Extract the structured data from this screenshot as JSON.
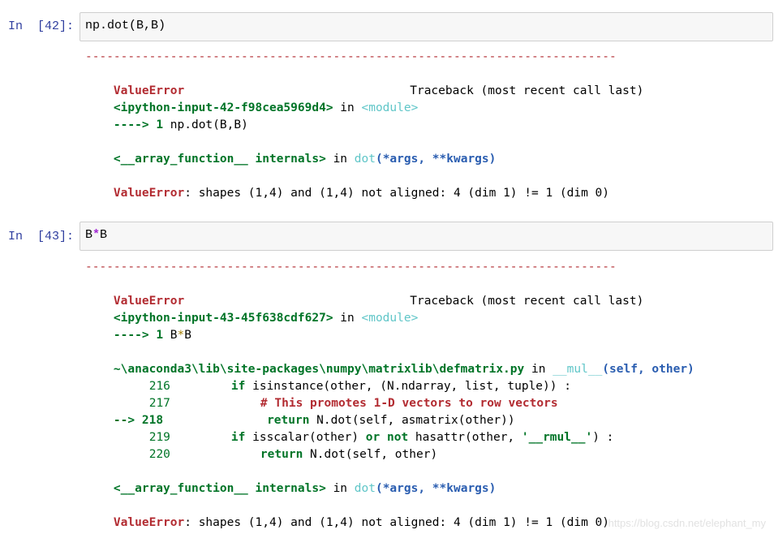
{
  "cells": [
    {
      "prompt": "In  [42]:",
      "code": {
        "fn": "np.dot",
        "args": "(B,B)"
      },
      "output": {
        "dashes": "---------------------------------------------------------------------------",
        "err_name": "ValueError",
        "tb_header": "Traceback (most recent call last)",
        "input_ref": "<ipython-input-42-f98cea5969d4>",
        "in_word": "in",
        "module": "<module>",
        "arrow": "---->",
        "line_no": "1",
        "line_code": "np.dot(B,B)",
        "internals": "<__array_function__ internals>",
        "internals_in": "in",
        "internals_fn": "dot",
        "internals_args": "(*args, **kwargs)",
        "err_label": "ValueError",
        "err_msg": ": shapes (1,4) and (1,4) not aligned: 4 (dim 1) != 1 (dim 0)"
      }
    },
    {
      "prompt": "In  [43]:",
      "code": {
        "a": "B",
        "op": "*",
        "b": "B"
      },
      "output": {
        "dashes": "---------------------------------------------------------------------------",
        "err_name": "ValueError",
        "tb_header": "Traceback (most recent call last)",
        "input_ref": "<ipython-input-43-45f638cdf627>",
        "in_word": "in",
        "module": "<module>",
        "arrow": "---->",
        "line_no": "1",
        "line_code_a": "B",
        "line_code_op": "*",
        "line_code_b": "B",
        "file_path": "~\\anaconda3\\lib\\site-packages\\numpy\\matrixlib\\defmatrix.py",
        "file_in": "in",
        "file_fn": "__mul__",
        "file_args": "(self, other)",
        "src": {
          "l216_no": "216",
          "l216_kw": "if",
          "l216_code": " isinstance(other, (N.ndarray, list, tuple)) :",
          "l217_no": "217",
          "l217_comment": "# This promotes 1-D vectors to row vectors",
          "l218_arrow": "-->",
          "l218_no": "218",
          "l218_kw": "return",
          "l218_code": " N.dot(self, asmatrix(other))",
          "l219_no": "219",
          "l219_kw": "if",
          "l219_code1": " isscalar(other) ",
          "l219_or": "or",
          "l219_sp": " ",
          "l219_not": "not",
          "l219_code2": " hasattr(other, ",
          "l219_str": "'__rmul__'",
          "l219_code3": ") :",
          "l220_no": "220",
          "l220_kw": "return",
          "l220_code": " N.dot(self, other)"
        },
        "internals": "<__array_function__ internals>",
        "internals_in": "in",
        "internals_fn": "dot",
        "internals_args": "(*args, **kwargs)",
        "err_label": "ValueError",
        "err_msg": ": shapes (1,4) and (1,4) not aligned: 4 (dim 1) != 1 (dim 0)"
      }
    }
  ],
  "watermark": "https://blog.csdn.net/elephant_my",
  "colors": {
    "error_red": "#b22b31",
    "keyword_green": "#007427",
    "module_cyan": "#60c6c8",
    "args_blue": "#2a5db0",
    "prompt_blue": "#303f9f"
  }
}
